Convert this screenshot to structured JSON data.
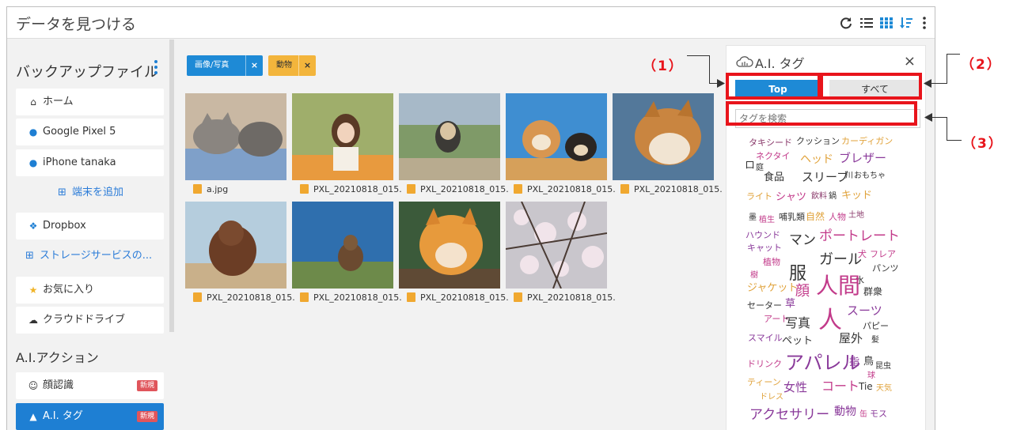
{
  "header": {
    "title": "データを見つける"
  },
  "sidebar": {
    "title": "バックアップファイル",
    "items": [
      {
        "label": "ホーム",
        "icon": "home-icon"
      },
      {
        "label": "Google Pixel 5",
        "icon": "android-icon"
      },
      {
        "label": "iPhone tanaka",
        "icon": "apple-icon"
      }
    ],
    "add_device": "端末を追加",
    "dropbox": "Dropbox",
    "add_storage": "ストレージサービスの...",
    "favorites": "お気に入り",
    "cloud_drive": "クラウドドライブ",
    "ai_section": "A.I.アクション",
    "ai_items": [
      {
        "label": "顔認識",
        "badge": "新規"
      },
      {
        "label": "A.I. タグ",
        "badge": "新規"
      }
    ]
  },
  "filters": [
    {
      "label": "画像/写真",
      "color": "#1e8ad6"
    },
    {
      "label": "動物",
      "color": "#f3b53c"
    }
  ],
  "files": [
    "a.jpg",
    "PXL_20210818_015...",
    "PXL_20210818_015...",
    "PXL_20210818_015...",
    "PXL_20210818_015...",
    "PXL_20210818_015...",
    "PXL_20210818_015...",
    "PXL_20210818_015...",
    "PXL_20210818_015..."
  ],
  "panel": {
    "title": "A.I. タグ",
    "close": "×",
    "tab_top": "Top",
    "tab_all": "すべて",
    "search_placeholder": "タグを検索"
  },
  "tags": [
    "タキシード",
    "クッション",
    "カーディガン",
    "ネクタイ",
    "ロ",
    "庭",
    "ヘッド",
    "ブレザー",
    "食品",
    "スリーブ",
    "川",
    "おもちゃ",
    "ライト",
    "シャツ",
    "飲料",
    "鍋",
    "キッド",
    "墨",
    "植生",
    "哺乳類",
    "自然",
    "人物",
    "土地",
    "ハウンド",
    "マン",
    "ポートレート",
    "キャット",
    "植物",
    "ガール",
    "犬",
    "フレア",
    "樹",
    "服",
    "パンツ",
    "水",
    "ジャケット",
    "顔",
    "人間",
    "群衆",
    "セーター",
    "草",
    "スーツ",
    "アート",
    "写真",
    "人",
    "パピー",
    "スマイル",
    "ペット",
    "屋外",
    "髪",
    "ドリンク",
    "アパレル",
    "指",
    "鳥",
    "昆虫",
    "球",
    "ティーン",
    "女性",
    "コート",
    "Tie",
    "天気",
    "ドレス",
    "アクセサリー",
    "動物",
    "缶",
    "モス"
  ],
  "callouts": [
    "（1）",
    "（2）",
    "（3）"
  ],
  "colors": {
    "accent": "#1e8ad6",
    "highlight": "#e8141b",
    "new_badge": "#e0555b"
  }
}
